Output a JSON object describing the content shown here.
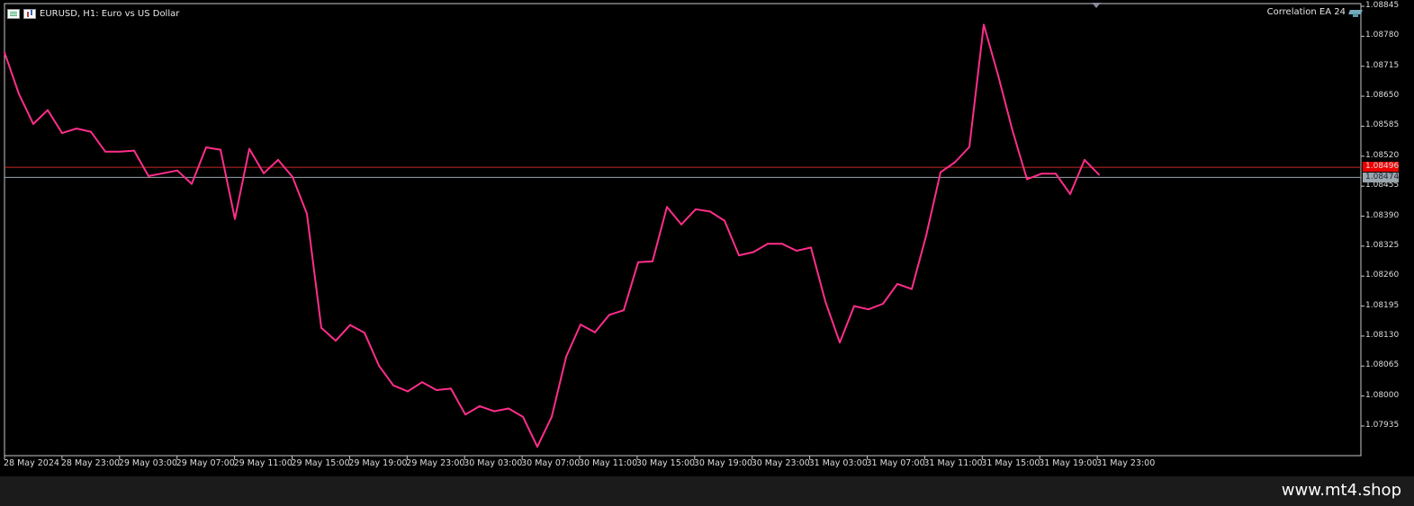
{
  "window": {
    "symbol_title": "EURUSD, H1:  Euro vs US Dollar",
    "ea_label": "Correlation EA 24",
    "watermark": "www.mt4.shop"
  },
  "colors": {
    "background": "#000000",
    "line": "#ff2e8a",
    "frame": "#c8c8c8",
    "bid_line": "#c62828",
    "ask_line": "#9aa6ae"
  },
  "icons": [
    "window-list-icon",
    "chart-type-icon",
    "graduation-cap-icon",
    "scroll-marker-icon"
  ],
  "chart_data": {
    "type": "line",
    "ylim": [
      1.079,
      1.08845
    ],
    "y_ticks": [
      "1.08845",
      "1.08780",
      "1.08715",
      "1.08650",
      "1.08585",
      "1.08520",
      "1.08455",
      "1.08390",
      "1.08325",
      "1.08260",
      "1.08195",
      "1.08130",
      "1.08065",
      "1.08000",
      "1.07935"
    ],
    "x_ticks": [
      "28 May 2024",
      "28 May 23:00",
      "29 May 03:00",
      "29 May 07:00",
      "29 May 11:00",
      "29 May 15:00",
      "29 May 19:00",
      "29 May 23:00",
      "30 May 03:00",
      "30 May 07:00",
      "30 May 11:00",
      "30 May 15:00",
      "30 May 19:00",
      "30 May 23:00",
      "31 May 03:00",
      "31 May 07:00",
      "31 May 11:00",
      "31 May 15:00",
      "31 May 19:00",
      "31 May 23:00"
    ],
    "price_tags": {
      "bid": "1.08496",
      "ask": "1.08474"
    },
    "series": [
      {
        "values": [
          1.08745,
          1.08655,
          1.0859,
          1.0862,
          1.0857,
          1.0858,
          1.08573,
          1.0853,
          1.0853,
          1.08532,
          1.08477,
          1.08483,
          1.08489,
          1.0846,
          1.08539,
          1.08534,
          1.08384,
          1.08536,
          1.08483,
          1.08512,
          1.08475,
          1.08395,
          1.08148,
          1.0812,
          1.08154,
          1.08137,
          1.08066,
          1.08023,
          1.0801,
          1.0803,
          1.08013,
          1.08016,
          1.0796,
          1.07978,
          1.07967,
          1.07973,
          1.07955,
          1.0789,
          1.07955,
          1.08085,
          1.08155,
          1.08138,
          1.08176,
          1.08186,
          1.0829,
          1.08292,
          1.0841,
          1.08372,
          1.08405,
          1.084,
          1.0838,
          1.08305,
          1.08312,
          1.0833,
          1.0833,
          1.08315,
          1.08322,
          1.08205,
          1.08116,
          1.08195,
          1.08188,
          1.082,
          1.08243,
          1.08232,
          1.08348,
          1.08485,
          1.08507,
          1.0854,
          1.08805,
          1.08695,
          1.08575,
          1.0847,
          1.08482,
          1.08482,
          1.08438,
          1.08512,
          1.0848
        ]
      }
    ]
  }
}
